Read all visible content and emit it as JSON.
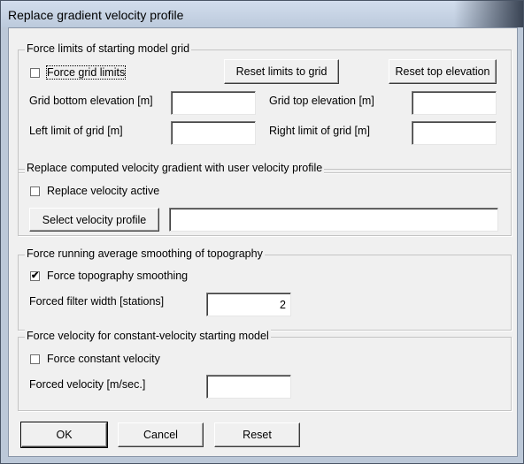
{
  "window": {
    "title": "Replace gradient velocity profile"
  },
  "grid_limits": {
    "legend": "Force limits of starting model grid",
    "force_checkbox_label": "Force grid limits",
    "force_checked": false,
    "reset_limits_button": "Reset limits to grid",
    "reset_top_button": "Reset top elevation",
    "bottom_label": "Grid bottom elevation [m]",
    "bottom_value": "",
    "top_label": "Grid top elevation [m]",
    "top_value": "",
    "left_label": "Left limit of grid [m]",
    "left_value": "",
    "right_label": "Right limit of grid [m]",
    "right_value": ""
  },
  "velocity_profile": {
    "legend": "Replace computed velocity gradient with user velocity profile",
    "active_label": "Replace velocity active",
    "active_checked": false,
    "select_button": "Select velocity profile",
    "profile_value": ""
  },
  "smoothing": {
    "legend": "Force running average smoothing of topography",
    "force_label": "Force topography smoothing",
    "force_checked": true,
    "width_label": "Forced filter width [stations]",
    "width_value": "2"
  },
  "constant_velocity": {
    "legend": "Force velocity for constant-velocity starting model",
    "force_label": "Force constant velocity",
    "force_checked": false,
    "velocity_label": "Forced velocity [m/sec.]",
    "velocity_value": ""
  },
  "footer": {
    "ok_button": "OK",
    "cancel_button": "Cancel",
    "reset_button": "Reset"
  },
  "checkmark": "✔"
}
